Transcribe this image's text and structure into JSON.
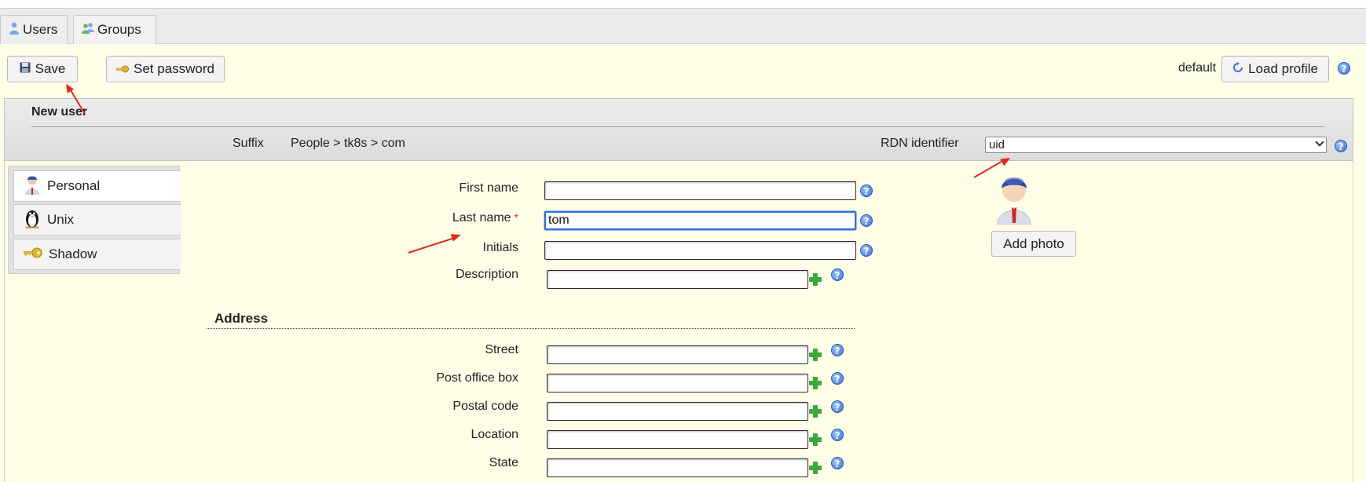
{
  "tabs": [
    {
      "label": "Users",
      "icon": "user-icon"
    },
    {
      "label": "Groups",
      "icon": "group-icon"
    }
  ],
  "toolbar": {
    "save_label": "Save",
    "set_password_label": "Set password",
    "profile_name": "default",
    "load_profile_label": "Load profile"
  },
  "panel": {
    "title": "New user",
    "suffix_label": "Suffix",
    "suffix_value": "People > tk8s > com",
    "rdn_label": "RDN identifier",
    "rdn_value": "uid"
  },
  "side_tabs": [
    {
      "label": "Personal",
      "icon": "person-icon"
    },
    {
      "label": "Unix",
      "icon": "penguin-icon"
    },
    {
      "label": "Shadow",
      "icon": "key-icon"
    }
  ],
  "form": {
    "first_name_label": "First name",
    "first_name_value": "",
    "last_name_label": "Last name",
    "last_name_required": "*",
    "last_name_value": "tom",
    "initials_label": "Initials",
    "initials_value": "",
    "description_label": "Description",
    "description_value": ""
  },
  "address": {
    "title": "Address",
    "street_label": "Street",
    "po_box_label": "Post office box",
    "postal_code_label": "Postal code",
    "location_label": "Location",
    "state_label": "State"
  },
  "photo": {
    "add_photo_label": "Add photo"
  },
  "colors": {
    "page_background": "#ffffe8",
    "focus_border": "#2f6fdb",
    "required_marker": "#e3262a",
    "annotation_arrow": "#e02a20"
  }
}
